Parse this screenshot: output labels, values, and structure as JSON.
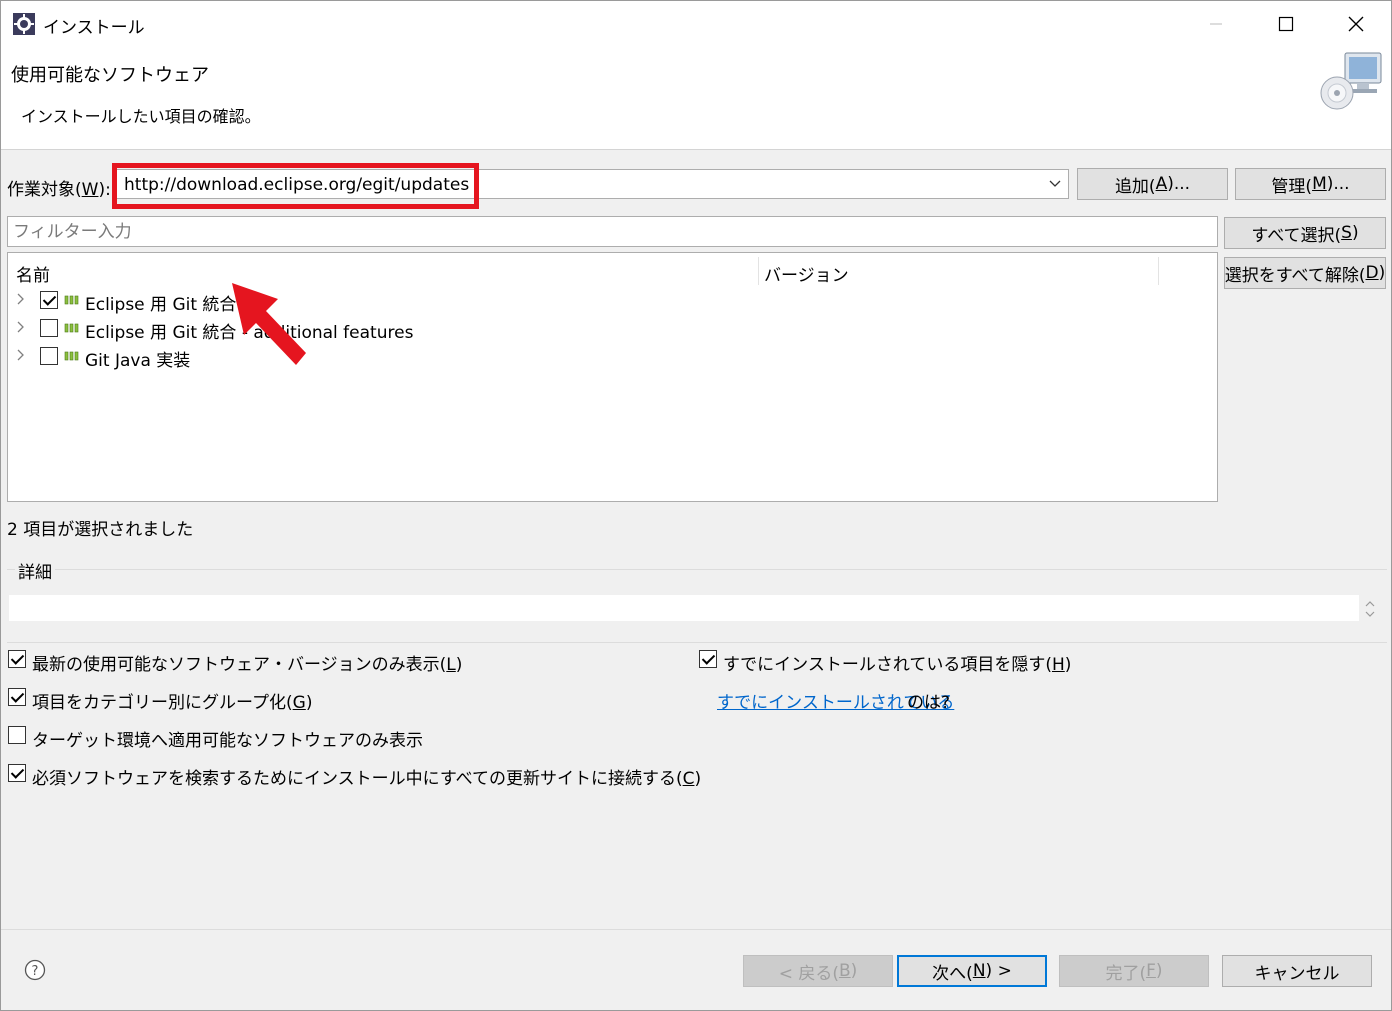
{
  "window": {
    "title": "インストール"
  },
  "header": {
    "title": "使用可能なソフトウェア",
    "description": "インストールしたい項目の確認。"
  },
  "work_with": {
    "label_pre": "作業対象(",
    "label_key": "W",
    "label_post": "):",
    "value": "http://download.eclipse.org/egit/updates",
    "add_pre": "追加(",
    "add_key": "A",
    "add_post": ")...",
    "manage_pre": "管理(",
    "manage_key": "M",
    "manage_post": ")..."
  },
  "filter": {
    "placeholder": "フィルター入力"
  },
  "select_all": {
    "pre": "すべて選択(",
    "key": "S",
    "post": ")"
  },
  "deselect_all": {
    "pre": "選択をすべて解除(",
    "key": "D",
    "post": ")"
  },
  "tree": {
    "columns": {
      "name": "名前",
      "version": "バージョン"
    },
    "items": [
      {
        "label": "Eclipse 用 Git 統合",
        "checked": true
      },
      {
        "label": "Eclipse 用 Git 統合 - additional features",
        "checked": false
      },
      {
        "label": "Git Java 実装",
        "checked": false
      }
    ]
  },
  "status": "2 項目が選択されました",
  "details": {
    "label": "詳細"
  },
  "options": {
    "latest": {
      "pre": "最新の使用可能なソフトウェア・バージョンのみ表示(",
      "key": "L",
      "post": ")",
      "checked": true
    },
    "group": {
      "pre": "項目をカテゴリー別にグループ化(",
      "key": "G",
      "post": ")",
      "checked": true
    },
    "target": {
      "text": "ターゲット環境へ適用可能なソフトウェアのみ表示",
      "checked": false
    },
    "contact": {
      "pre": "必須ソフトウェアを検索するためにインストール中にすべての更新サイトに接続する(",
      "key": "C",
      "post": ")",
      "checked": true
    },
    "hide": {
      "pre": "すでにインストールされている項目を隠す(",
      "key": "H",
      "post": ")",
      "checked": true
    },
    "already_link": "すでにインストールされている",
    "already_suffix": " のは?"
  },
  "footer": {
    "back": {
      "pre": "< 戻る(",
      "key": "B",
      "post": ")"
    },
    "next": {
      "pre": "次へ(",
      "key": "N",
      "post": ") >"
    },
    "finish": {
      "pre": "完了(",
      "key": "F",
      "post": ")"
    },
    "cancel": "キャンセル"
  },
  "colors": {
    "accent": "#0078d7",
    "annotation": "#e5151f",
    "link": "#0066cc"
  }
}
